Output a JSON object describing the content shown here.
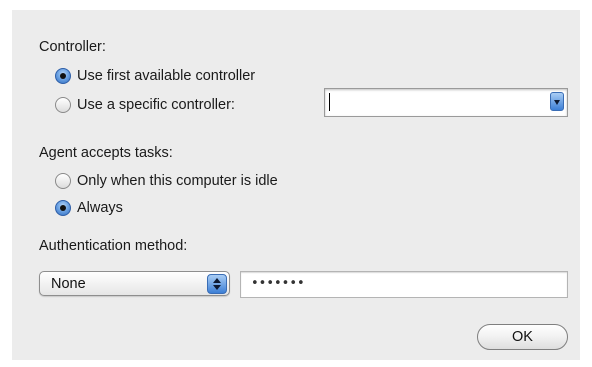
{
  "dialog": {
    "controller": {
      "label": "Controller:",
      "options": [
        {
          "label": "Use first available controller",
          "selected": true
        },
        {
          "label": "Use a specific controller:",
          "selected": false
        }
      ],
      "specific_controller_value": ""
    },
    "agent_tasks": {
      "label": "Agent accepts tasks:",
      "options": [
        {
          "label": "Only when this computer is idle",
          "selected": false
        },
        {
          "label": "Always",
          "selected": true
        }
      ]
    },
    "authentication": {
      "label": "Authentication method:",
      "method_selected": "None",
      "password_masked": "•••••••"
    },
    "ok_label": "OK"
  }
}
